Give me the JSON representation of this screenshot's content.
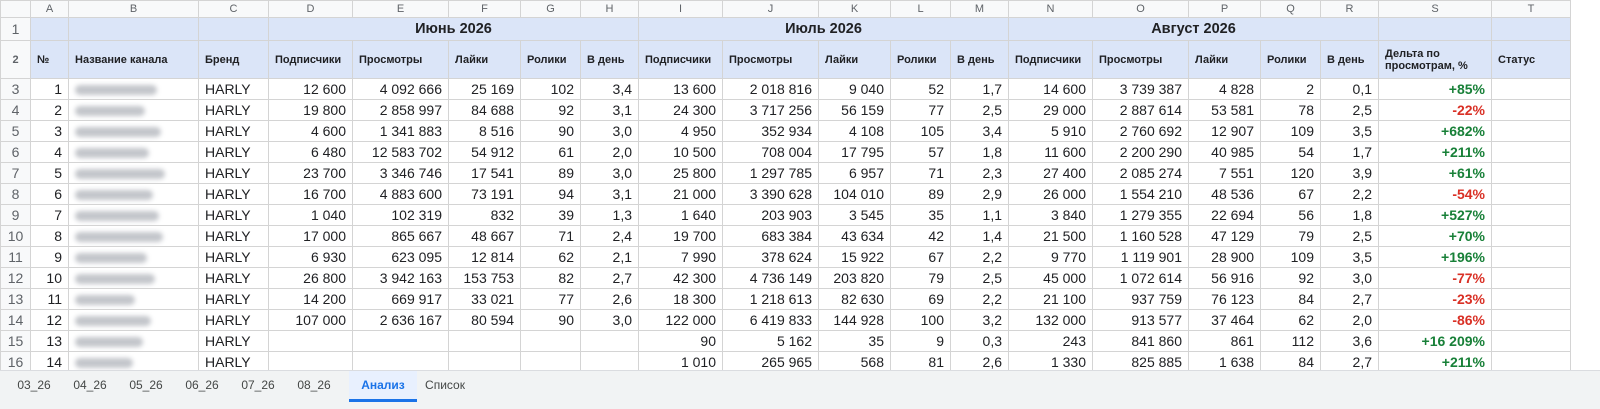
{
  "column_letters": [
    "A",
    "B",
    "C",
    "D",
    "E",
    "F",
    "G",
    "H",
    "I",
    "J",
    "K",
    "L",
    "M",
    "N",
    "O",
    "P",
    "Q",
    "R",
    "S",
    "T"
  ],
  "row_numbers": [
    "1",
    "2",
    "3",
    "4",
    "5",
    "6",
    "7",
    "8",
    "9",
    "10",
    "11",
    "12",
    "13",
    "14",
    "15",
    "16"
  ],
  "months": [
    "Июнь 2026",
    "Июль 2026",
    "Август 2026"
  ],
  "headers": {
    "num": "№",
    "channel": "Название канала",
    "brand": "Бренд",
    "subs": "Подписчики",
    "views": "Просмотры",
    "likes": "Лайки",
    "videos": "Ролики",
    "perday": "В день",
    "delta": "Дельта по просмотрам, %",
    "status": "Статус"
  },
  "rows": [
    {
      "n": "1",
      "brand": "HARLY",
      "jun": [
        "12 600",
        "4 092 666",
        "25 169",
        "102",
        "3,4"
      ],
      "jul": [
        "13 600",
        "2 018 816",
        "9 040",
        "52",
        "1,7"
      ],
      "aug": [
        "14 600",
        "3 739 387",
        "4 828",
        "2",
        "0,1"
      ],
      "delta": "+85%",
      "dir": "pos"
    },
    {
      "n": "2",
      "brand": "HARLY",
      "jun": [
        "19 800",
        "2 858 997",
        "84 688",
        "92",
        "3,1"
      ],
      "jul": [
        "24 300",
        "3 717 256",
        "56 159",
        "77",
        "2,5"
      ],
      "aug": [
        "29 000",
        "2 887 614",
        "53 581",
        "78",
        "2,5"
      ],
      "delta": "-22%",
      "dir": "neg"
    },
    {
      "n": "3",
      "brand": "HARLY",
      "jun": [
        "4 600",
        "1 341 883",
        "8 516",
        "90",
        "3,0"
      ],
      "jul": [
        "4 950",
        "352 934",
        "4 108",
        "105",
        "3,4"
      ],
      "aug": [
        "5 910",
        "2 760 692",
        "12 907",
        "109",
        "3,5"
      ],
      "delta": "+682%",
      "dir": "pos"
    },
    {
      "n": "4",
      "brand": "HARLY",
      "jun": [
        "6 480",
        "12 583 702",
        "54 912",
        "61",
        "2,0"
      ],
      "jul": [
        "10 500",
        "708 004",
        "17 795",
        "57",
        "1,8"
      ],
      "aug": [
        "11 600",
        "2 200 290",
        "40 985",
        "54",
        "1,7"
      ],
      "delta": "+211%",
      "dir": "pos"
    },
    {
      "n": "5",
      "brand": "HARLY",
      "jun": [
        "23 700",
        "3 346 746",
        "17 541",
        "89",
        "3,0"
      ],
      "jul": [
        "25 800",
        "1 297 785",
        "6 957",
        "71",
        "2,3"
      ],
      "aug": [
        "27 400",
        "2 085 274",
        "7 551",
        "120",
        "3,9"
      ],
      "delta": "+61%",
      "dir": "pos"
    },
    {
      "n": "6",
      "brand": "HARLY",
      "jun": [
        "16 700",
        "4 883 600",
        "73 191",
        "94",
        "3,1"
      ],
      "jul": [
        "21 000",
        "3 390 628",
        "104 010",
        "89",
        "2,9"
      ],
      "aug": [
        "26 000",
        "1 554 210",
        "48 536",
        "67",
        "2,2"
      ],
      "delta": "-54%",
      "dir": "neg"
    },
    {
      "n": "7",
      "brand": "HARLY",
      "jun": [
        "1 040",
        "102 319",
        "832",
        "39",
        "1,3"
      ],
      "jul": [
        "1 640",
        "203 903",
        "3 545",
        "35",
        "1,1"
      ],
      "aug": [
        "3 840",
        "1 279 355",
        "22 694",
        "56",
        "1,8"
      ],
      "delta": "+527%",
      "dir": "pos"
    },
    {
      "n": "8",
      "brand": "HARLY",
      "jun": [
        "17 000",
        "865 667",
        "48 667",
        "71",
        "2,4"
      ],
      "jul": [
        "19 700",
        "683 384",
        "43 634",
        "42",
        "1,4"
      ],
      "aug": [
        "21 500",
        "1 160 528",
        "47 129",
        "79",
        "2,5"
      ],
      "delta": "+70%",
      "dir": "pos"
    },
    {
      "n": "9",
      "brand": "HARLY",
      "jun": [
        "6 930",
        "623 095",
        "12 814",
        "62",
        "2,1"
      ],
      "jul": [
        "7 990",
        "378 624",
        "15 922",
        "67",
        "2,2"
      ],
      "aug": [
        "9 770",
        "1 119 901",
        "28 900",
        "109",
        "3,5"
      ],
      "delta": "+196%",
      "dir": "pos"
    },
    {
      "n": "10",
      "brand": "HARLY",
      "jun": [
        "26 800",
        "3 942 163",
        "153 753",
        "82",
        "2,7"
      ],
      "jul": [
        "42 300",
        "4 736 149",
        "203 820",
        "79",
        "2,5"
      ],
      "aug": [
        "45 000",
        "1 072 614",
        "56 916",
        "92",
        "3,0"
      ],
      "delta": "-77%",
      "dir": "neg"
    },
    {
      "n": "11",
      "brand": "HARLY",
      "jun": [
        "14 200",
        "669 917",
        "33 021",
        "77",
        "2,6"
      ],
      "jul": [
        "18 300",
        "1 218 613",
        "82 630",
        "69",
        "2,2"
      ],
      "aug": [
        "21 100",
        "937 759",
        "76 123",
        "84",
        "2,7"
      ],
      "delta": "-23%",
      "dir": "neg"
    },
    {
      "n": "12",
      "brand": "HARLY",
      "jun": [
        "107 000",
        "2 636 167",
        "80 594",
        "90",
        "3,0"
      ],
      "jul": [
        "122 000",
        "6 419 833",
        "144 928",
        "100",
        "3,2"
      ],
      "aug": [
        "132 000",
        "913 577",
        "37 464",
        "62",
        "2,0"
      ],
      "delta": "-86%",
      "dir": "neg"
    },
    {
      "n": "13",
      "brand": "HARLY",
      "jun": [
        "",
        "",
        "",
        "",
        ""
      ],
      "jul": [
        "90",
        "5 162",
        "35",
        "9",
        "0,3"
      ],
      "aug": [
        "243",
        "841 860",
        "861",
        "112",
        "3,6"
      ],
      "delta": "+16 209%",
      "dir": "pos"
    },
    {
      "n": "14",
      "brand": "HARLY",
      "jun": [
        "",
        "",
        "",
        "",
        ""
      ],
      "jul": [
        "1 010",
        "265 965",
        "568",
        "81",
        "2,6"
      ],
      "aug": [
        "1 330",
        "825 885",
        "1 638",
        "84",
        "2,7"
      ],
      "delta": "+211%",
      "dir": "pos"
    }
  ],
  "sheet_tabs": [
    {
      "label": "03_26",
      "active": false
    },
    {
      "label": "04_26",
      "active": false
    },
    {
      "label": "05_26",
      "active": false
    },
    {
      "label": "06_26",
      "active": false
    },
    {
      "label": "07_26",
      "active": false
    },
    {
      "label": "08_26",
      "active": false
    },
    {
      "label": "Анализ",
      "active": true
    },
    {
      "label": "Список",
      "active": false
    }
  ],
  "colors": {
    "header_fill": "#dbe5f8",
    "positive": "#188038",
    "negative": "#d93025",
    "accent": "#1a73e8"
  }
}
